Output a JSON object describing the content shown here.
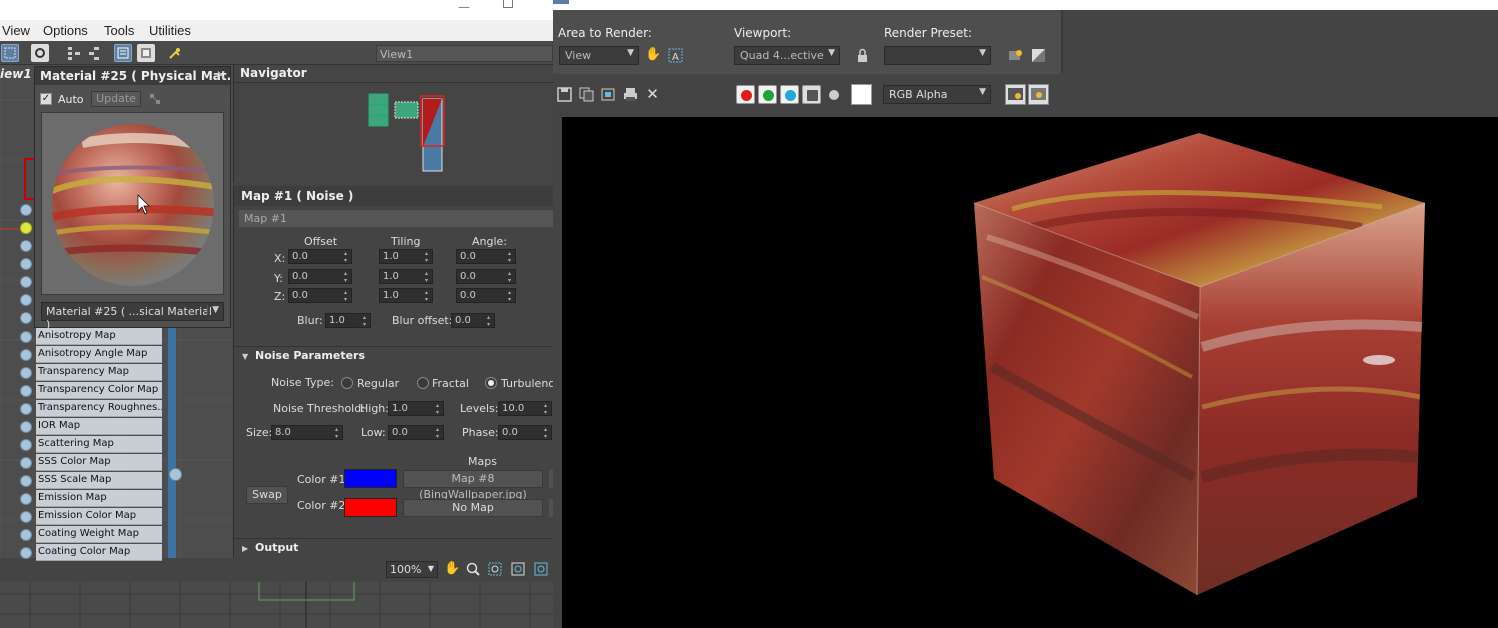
{
  "menu": {
    "view": "View",
    "options": "Options",
    "tools": "Tools",
    "utilities": "Utilities"
  },
  "toolbar": {
    "view_name": "View1"
  },
  "view_tab": "iew1",
  "material_preview": {
    "title": "Material #25 ( Physical Mat...",
    "auto_label": "Auto",
    "update_label": "Update",
    "selected_material": "Material #25 ( ...sical Material )"
  },
  "map_slots": [
    "Anisotropy Map",
    "Anisotropy Angle Map",
    "Transparency Map",
    "Transparency Color Map",
    "Transparency Roughnes...",
    "IOR Map",
    "Scattering Map",
    "SSS Color Map",
    "SSS Scale Map",
    "Emission Map",
    "Emission Color Map",
    "Coating Weight Map",
    "Coating Color Map"
  ],
  "navigator": {
    "title": "Navigator"
  },
  "map": {
    "title": "Map #1  ( Noise )",
    "name": "Map #1",
    "coords": {
      "offset_label": "Offset",
      "tiling_label": "Tiling",
      "angle_label": "Angle:",
      "x_label": "X:",
      "y_label": "Y:",
      "z_label": "Z:",
      "offset": [
        "0.0",
        "0.0",
        "0.0"
      ],
      "tiling": [
        "1.0",
        "1.0",
        "1.0"
      ],
      "angle": [
        "0.0",
        "0.0",
        "0.0"
      ],
      "blur_label": "Blur:",
      "blur": "1.0",
      "blur_offset_label": "Blur offset:",
      "blur_offset": "0.0"
    },
    "noise": {
      "section_title": "Noise Parameters",
      "type_label": "Noise Type:",
      "types": [
        "Regular",
        "Fractal",
        "Turbulence"
      ],
      "selected_type": "Turbulence",
      "threshold_label": "Noise Threshold:",
      "high_label": "High:",
      "high": "1.0",
      "low_label": "Low:",
      "low": "0.0",
      "levels_label": "Levels:",
      "levels": "10.0",
      "phase_label": "Phase:",
      "phase": "0.0",
      "size_label": "Size:",
      "size": "8.0",
      "maps_label": "Maps",
      "swap_label": "Swap",
      "color1_label": "Color #1",
      "color1": "#0000ff",
      "color1_map": "Map #8 (BingWallpaper.jpg)",
      "color2_label": "Color #2",
      "color2": "#ff0000",
      "color2_map": "No Map"
    },
    "output_title": "Output"
  },
  "zoom": "100%",
  "render": {
    "area_label": "Area to Render:",
    "area_value": "View",
    "viewport_label": "Viewport:",
    "viewport_value": "Quad 4...ective",
    "preset_label": "Render Preset:",
    "preset_value": "",
    "channel_value": "RGB Alpha"
  },
  "colors": {
    "accent_blue": "#5b7ea8",
    "slot_bar": "#3b74a4"
  }
}
